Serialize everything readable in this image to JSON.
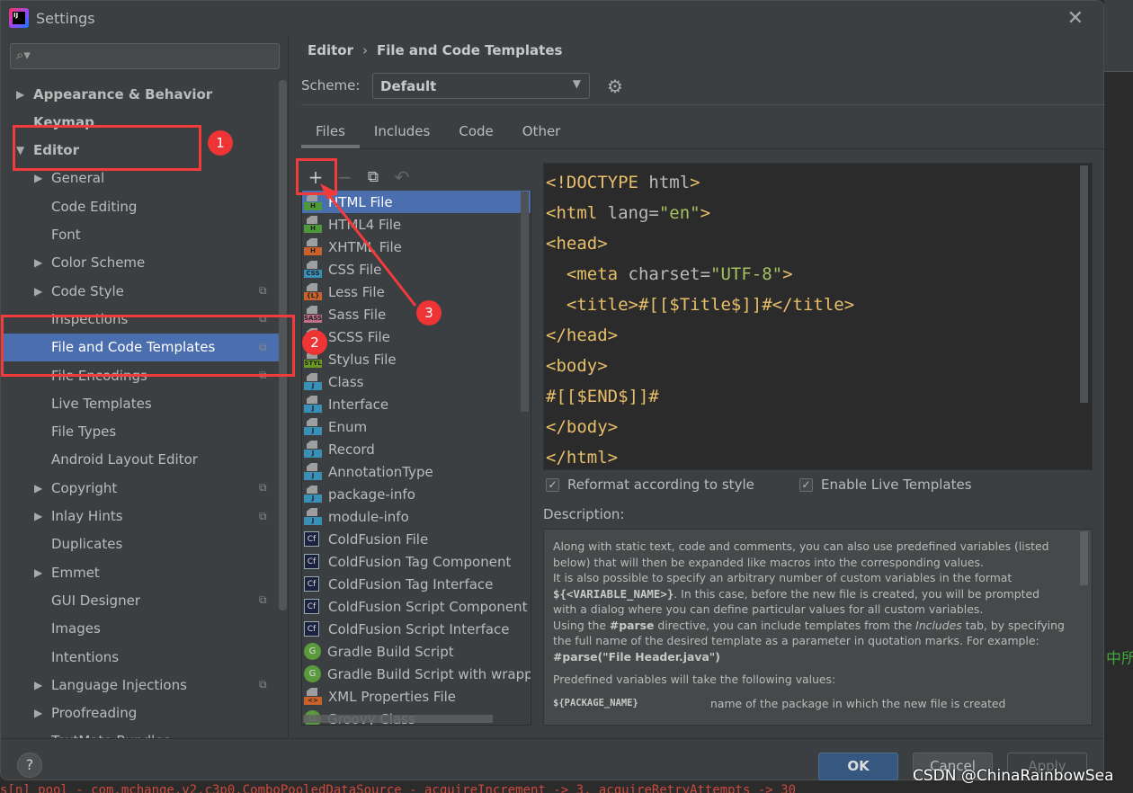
{
  "window": {
    "title": "Settings",
    "close_icon": "close-icon"
  },
  "background": {
    "side_text": "中所",
    "console_text": "s[n] pool - com.mchange.v2.c3p0.ComboPooledDataSource - acquireIncrement -> 3, acquireRetryAttempts -> 30"
  },
  "sidebar": {
    "search_placeholder": "",
    "items": [
      {
        "label": "Appearance & Behavior",
        "arrow": "▶",
        "bold": true
      },
      {
        "label": "Keymap",
        "bold": true
      },
      {
        "label": "Editor",
        "arrow": "▼",
        "bold": true
      },
      {
        "label": "General",
        "arrow": "▶"
      },
      {
        "label": "Code Editing"
      },
      {
        "label": "Font"
      },
      {
        "label": "Color Scheme",
        "arrow": "▶"
      },
      {
        "label": "Code Style",
        "arrow": "▶",
        "copy": true
      },
      {
        "label": "Inspections",
        "copy": true
      },
      {
        "label": "File and Code Templates",
        "copy": true,
        "selected": true
      },
      {
        "label": "File Encodings",
        "copy": true
      },
      {
        "label": "Live Templates"
      },
      {
        "label": "File Types"
      },
      {
        "label": "Android Layout Editor"
      },
      {
        "label": "Copyright",
        "arrow": "▶",
        "copy": true
      },
      {
        "label": "Inlay Hints",
        "arrow": "▶",
        "copy": true
      },
      {
        "label": "Duplicates"
      },
      {
        "label": "Emmet",
        "arrow": "▶"
      },
      {
        "label": "GUI Designer",
        "copy": true
      },
      {
        "label": "Images"
      },
      {
        "label": "Intentions"
      },
      {
        "label": "Language Injections",
        "arrow": "▶",
        "copy": true
      },
      {
        "label": "Proofreading",
        "arrow": "▶"
      },
      {
        "label": "TextMate Bundles"
      }
    ]
  },
  "breadcrumb": {
    "parent": "Editor",
    "separator": "›",
    "current": "File and Code Templates"
  },
  "scheme": {
    "label": "Scheme:",
    "value": "Default"
  },
  "tabs": [
    "Files",
    "Includes",
    "Code",
    "Other"
  ],
  "active_tab": "Files",
  "toolbar": {
    "add": "+",
    "remove": "−",
    "copy": "⧉",
    "reset": "↶"
  },
  "templates": [
    {
      "label": "HTML File",
      "badge": "H",
      "color": "#4e9a3a",
      "selected": true
    },
    {
      "label": "HTML4 File",
      "badge": "H",
      "color": "#4e9a3a"
    },
    {
      "label": "XHTML File",
      "badge": "H",
      "color": "#c9612c"
    },
    {
      "label": "CSS File",
      "badge": "CSS",
      "color": "#3a8fb7"
    },
    {
      "label": "Less File",
      "badge": "{L}",
      "color": "#c9612c"
    },
    {
      "label": "Sass File",
      "badge": "SASS",
      "color": "#c2708a"
    },
    {
      "label": "SCSS File",
      "badge": "SCSS",
      "color": "#c2708a"
    },
    {
      "label": "Stylus File",
      "badge": "STYL",
      "color": "#6a9a1f"
    },
    {
      "label": "Class",
      "badge": "J",
      "color": "#3a8fb7"
    },
    {
      "label": "Interface",
      "badge": "J",
      "color": "#3a8fb7"
    },
    {
      "label": "Enum",
      "badge": "J",
      "color": "#3a8fb7"
    },
    {
      "label": "Record",
      "badge": "J",
      "color": "#3a8fb7"
    },
    {
      "label": "AnnotationType",
      "badge": "J",
      "color": "#3a8fb7"
    },
    {
      "label": "package-info",
      "badge": "J",
      "color": "#3a8fb7"
    },
    {
      "label": "module-info",
      "badge": "J",
      "color": "#3a8fb7"
    },
    {
      "label": "ColdFusion File",
      "kind": "cf",
      "badge": "Cf"
    },
    {
      "label": "ColdFusion Tag Component",
      "kind": "cf",
      "badge": "Cf"
    },
    {
      "label": "ColdFusion Tag Interface",
      "kind": "cf",
      "badge": "Cf"
    },
    {
      "label": "ColdFusion Script Component",
      "kind": "cf",
      "badge": "Cf"
    },
    {
      "label": "ColdFusion Script Interface",
      "kind": "cf",
      "badge": "Cf"
    },
    {
      "label": "Gradle Build Script",
      "kind": "g",
      "badge": "G"
    },
    {
      "label": "Gradle Build Script with wrapper",
      "kind": "g",
      "badge": "G"
    },
    {
      "label": "XML Properties File",
      "badge": "<>",
      "color": "#c9612c"
    },
    {
      "label": "Groovy Class",
      "kind": "g",
      "badge": "G"
    }
  ],
  "code_lines": [
    [
      [
        "t",
        "<!DOCTYPE "
      ],
      [
        "a",
        "html"
      ],
      [
        "t",
        ">"
      ]
    ],
    [
      [
        "t",
        "<html "
      ],
      [
        "a",
        "lang"
      ],
      [
        "a",
        "="
      ],
      [
        "v",
        "\"en\""
      ],
      [
        "t",
        ">"
      ]
    ],
    [
      [
        "t",
        "<head>"
      ]
    ],
    [
      [
        "t",
        "  <meta "
      ],
      [
        "a",
        "charset"
      ],
      [
        "a",
        "="
      ],
      [
        "v",
        "\"UTF-8\""
      ],
      [
        "t",
        ">"
      ]
    ],
    [
      [
        "t",
        "  <title>"
      ],
      [
        "x",
        "#[[$Title$]]#"
      ],
      [
        "t",
        "</title>"
      ]
    ],
    [
      [
        "t",
        "</head>"
      ]
    ],
    [
      [
        "t",
        "<body>"
      ]
    ],
    [
      [
        "x",
        "#[[$END$]]#"
      ]
    ],
    [
      [
        "t",
        "</body>"
      ]
    ],
    [
      [
        "t",
        "</html>"
      ]
    ]
  ],
  "options": {
    "reformat": {
      "label": "Reformat according to style",
      "checked": true
    },
    "live_templates": {
      "label": "Enable Live Templates",
      "checked": true
    }
  },
  "description": {
    "label": "Description:",
    "p1": "Along with static text, code and comments, you can also use predefined variables (listed below) that will then be expanded like macros into the corresponding values.",
    "p2a": "It is also possible to specify an arbitrary number of custom variables in the format ",
    "p2var": "${<VARIABLE_NAME>}",
    "p2b": ". In this case, before the new file is created, you will be prompted with a dialog where you can define particular values for all custom variables.",
    "p3a": "Using the ",
    "p3parse": "#parse",
    "p3b": " directive, you can include templates from the ",
    "p3inc": "Includes",
    "p3c": " tab, by specifying the full name of the desired template as a parameter in quotation marks. For example:",
    "p3ex": "#parse(\"File Header.java\")",
    "p4": "Predefined variables will take the following values:",
    "var_name": "${PACKAGE_NAME}",
    "var_desc": "name of the package in which the new file is created"
  },
  "buttons": {
    "help": "?",
    "ok": "OK",
    "cancel": "Cancel",
    "apply": "Apply"
  },
  "annotations": {
    "b1": "1",
    "b2": "2",
    "b3": "3",
    "color": "#f23c3c"
  },
  "watermark": "CSDN @ChinaRainbowSea"
}
